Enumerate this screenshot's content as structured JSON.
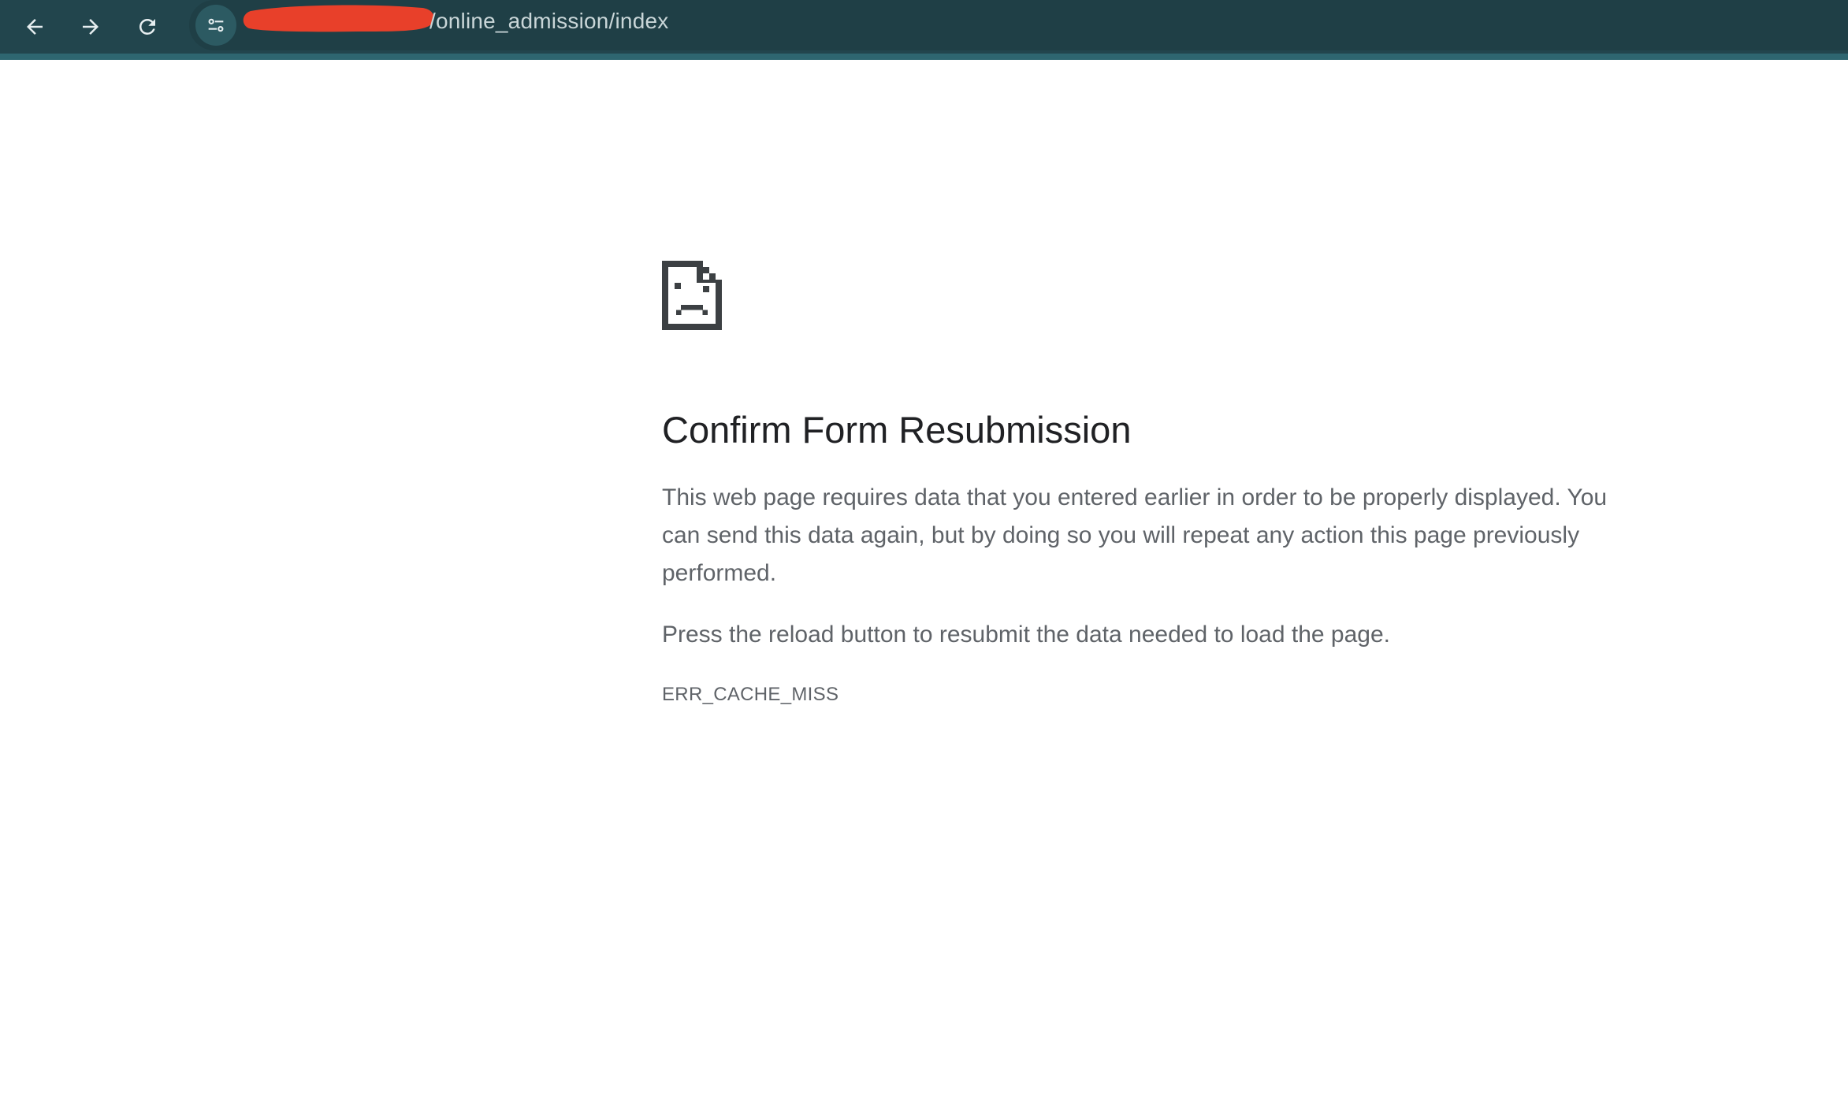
{
  "browser": {
    "url_path": "/online_admission/index",
    "nav": {
      "back_icon": "arrow-left-icon",
      "forward_icon": "arrow-right-icon",
      "reload_icon": "reload-icon",
      "site_info_icon": "tune-icon"
    },
    "colors": {
      "toolbar": "#22454d",
      "omnibox": "#1f3f46",
      "redaction": "#e8402a"
    }
  },
  "error_page": {
    "icon": "sad-document-icon",
    "title": "Confirm Form Resubmission",
    "description": "This web page requires data that you entered earlier in order to be properly displayed. You can send this data again, but by doing so you will repeat any action this page previously performed.",
    "instruction": "Press the reload button to resubmit the data needed to load the page.",
    "error_code": "ERR_CACHE_MISS"
  }
}
